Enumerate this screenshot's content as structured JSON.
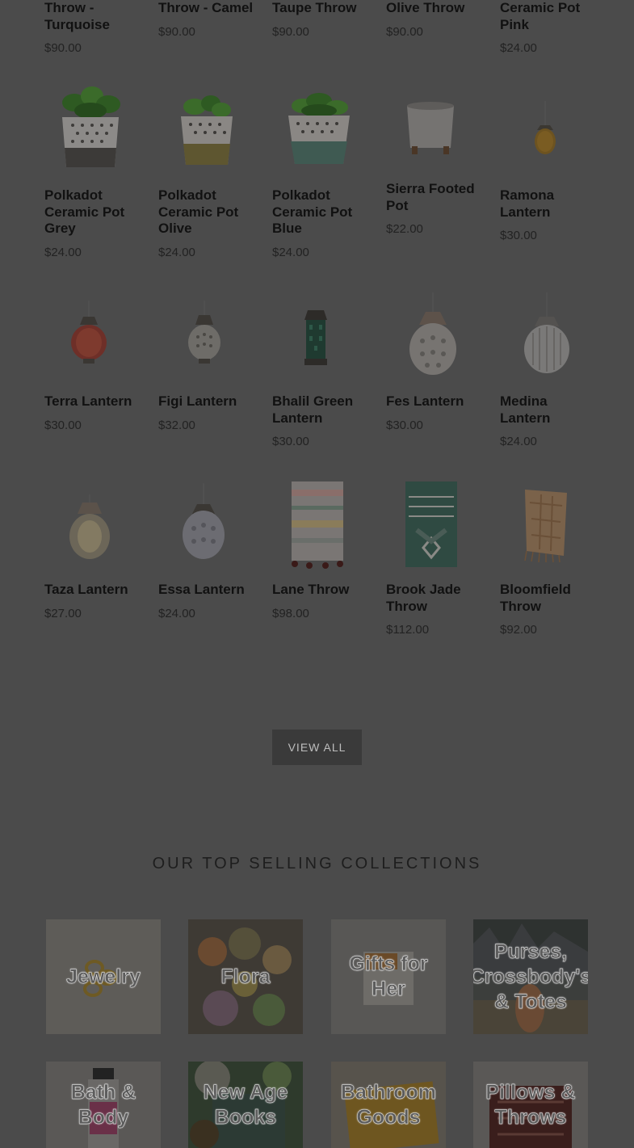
{
  "products": [
    {
      "title": "Throw - Turquoise",
      "price": "$90.00"
    },
    {
      "title": "Throw - Camel",
      "price": "$90.00"
    },
    {
      "title": "Taupe Throw",
      "price": "$90.00"
    },
    {
      "title": "Olive Throw",
      "price": "$90.00"
    },
    {
      "title": "Ceramic Pot Pink",
      "price": "$24.00"
    },
    {
      "title": "Polkadot Ceramic Pot Grey",
      "price": "$24.00"
    },
    {
      "title": "Polkadot Ceramic Pot Olive",
      "price": "$24.00"
    },
    {
      "title": "Polkadot Ceramic Pot Blue",
      "price": "$24.00"
    },
    {
      "title": "Sierra Footed Pot",
      "price": "$22.00"
    },
    {
      "title": "Ramona Lantern",
      "price": "$30.00"
    },
    {
      "title": "Terra Lantern",
      "price": "$30.00"
    },
    {
      "title": "Figi Lantern",
      "price": "$32.00"
    },
    {
      "title": "Bhalil Green Lantern",
      "price": "$30.00"
    },
    {
      "title": "Fes Lantern",
      "price": "$30.00"
    },
    {
      "title": "Medina Lantern",
      "price": "$24.00"
    },
    {
      "title": "Taza Lantern",
      "price": "$27.00"
    },
    {
      "title": "Essa Lantern",
      "price": "$24.00"
    },
    {
      "title": "Lane Throw",
      "price": "$98.00"
    },
    {
      "title": "Brook Jade Throw",
      "price": "$112.00"
    },
    {
      "title": "Bloomfield Throw",
      "price": "$92.00"
    }
  ],
  "view_all_label": "VIEW ALL",
  "collections_title": "OUR TOP SELLING COLLECTIONS",
  "collections": [
    {
      "label": "Jewelry"
    },
    {
      "label": "Flora"
    },
    {
      "label": "Gifts for Her"
    },
    {
      "label": "Purses, Crossbody's & Totes"
    },
    {
      "label": "Bath & Body"
    },
    {
      "label": "New Age Books"
    },
    {
      "label": "Bathroom Goods"
    },
    {
      "label": "Pillows & Throws"
    }
  ]
}
